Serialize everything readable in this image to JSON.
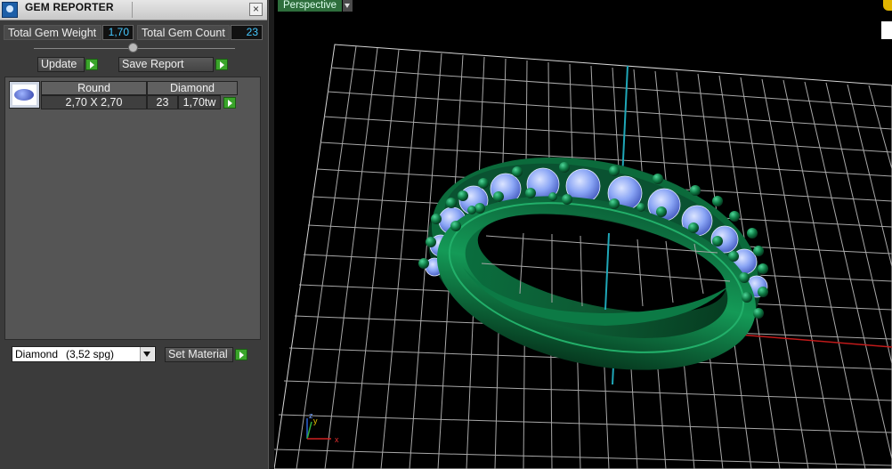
{
  "panel": {
    "title": "GEM REPORTER",
    "close_symbol": "×",
    "total_weight_label": "Total Gem Weight",
    "total_weight_value": "1,70",
    "total_count_label": "Total Gem Count",
    "total_count_value": "23",
    "update_label": "Update",
    "save_report_label": "Save Report",
    "table": {
      "headers": [
        "Round",
        "Diamond"
      ],
      "size": "2,70 X 2,70",
      "count": "23",
      "weight": "1,70tw"
    },
    "material": {
      "selected": "Diamond",
      "sg": "(3,52 spg)",
      "set_label": "Set Material"
    }
  },
  "viewport": {
    "view_name": "Perspective",
    "axes": {
      "x": "x",
      "y": "y",
      "z": "z"
    }
  },
  "colors": {
    "metal": "#0e7a44",
    "gem": "#8aa5f5",
    "grid": "#bdbdbd",
    "value_text": "#45c8ff"
  }
}
